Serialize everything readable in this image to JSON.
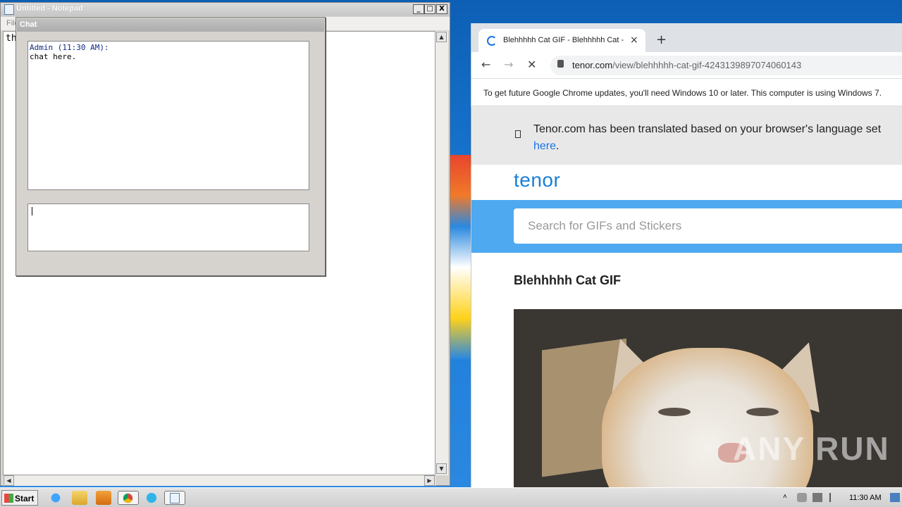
{
  "notepad": {
    "title": "Untitled - Notepad",
    "menu_first": "File",
    "text": "th",
    "buttons": {
      "minimize": "_",
      "maximize": "□",
      "close": "X"
    }
  },
  "chat": {
    "title": "Chat",
    "log_author": "Admin (11:30 AM):",
    "log_message": "chat here.",
    "input_value": ""
  },
  "browser": {
    "tab_title": "Blehhhhh Cat GIF - Blehhhhh Cat - Discover & Share GIFs",
    "tab_close": "×",
    "new_tab": "+",
    "back": "←",
    "forward": "→",
    "stop": "✕",
    "url_host": "tenor.com",
    "url_path": "/view/blehhhhh-cat-gif-4243139897074060143",
    "update_notice": "To get future Google Chrome updates, you'll need Windows 10 or later. This computer is using Windows 7.",
    "translate_message": "Tenor.com has been translated based on your browser's language set",
    "translate_link": "here",
    "translate_period": "."
  },
  "page": {
    "logo": "tenor",
    "search_placeholder": "Search for GIFs and Stickers",
    "gif_title": "Blehhhhh Cat GIF"
  },
  "watermark": "ANY RUN",
  "taskbar": {
    "start_label": "Start",
    "clock": "11:30 AM"
  }
}
